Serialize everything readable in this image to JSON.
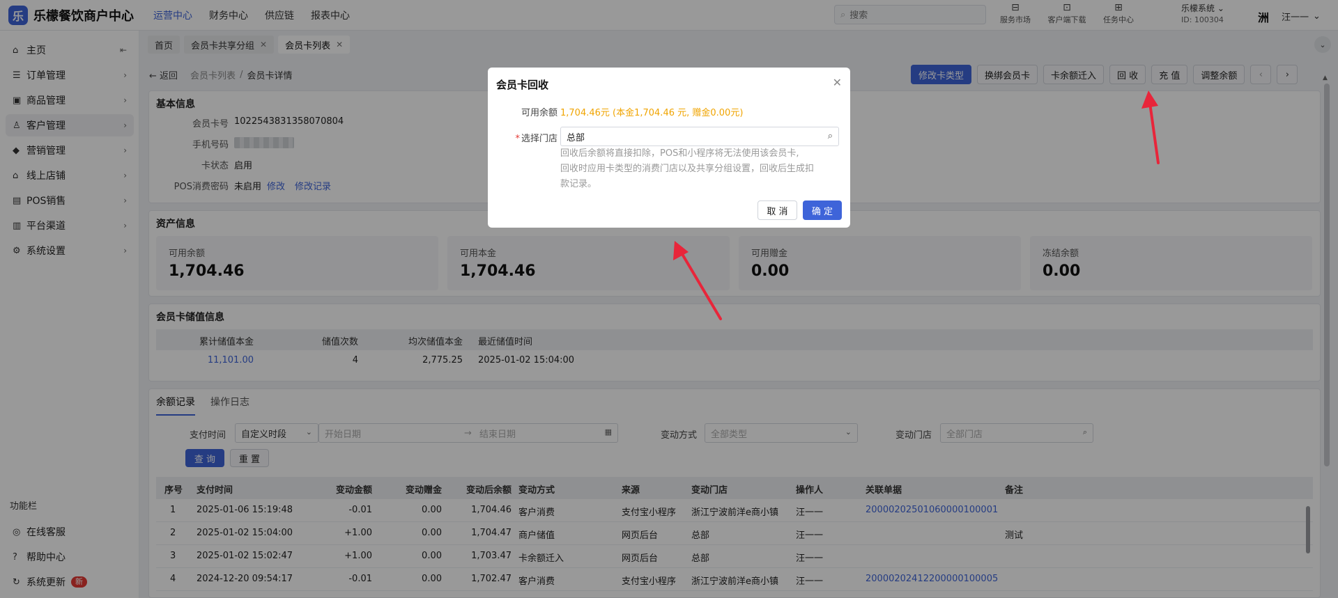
{
  "brand": {
    "mark": "乐",
    "name": "乐檬餐饮商户中心"
  },
  "topnav": [
    "运营中心",
    "财务中心",
    "供应链",
    "报表中心"
  ],
  "search": {
    "placeholder": "搜索"
  },
  "top_icons": [
    {
      "label": "服务市场",
      "icon": "store-icon"
    },
    {
      "label": "客户端下载",
      "icon": "download-icon"
    },
    {
      "label": "任务中心",
      "icon": "task-icon"
    }
  ],
  "user": {
    "system": "乐檬系统",
    "id_text": "ID: 100304",
    "name": "汪一一",
    "avatar_char": "洲"
  },
  "sidebar": {
    "items": [
      {
        "label": "主页",
        "icon": "home-icon",
        "glyph": "⌂"
      },
      {
        "label": "订单管理",
        "icon": "order-icon",
        "glyph": "☰"
      },
      {
        "label": "商品管理",
        "icon": "goods-icon",
        "glyph": "▣"
      },
      {
        "label": "客户管理",
        "icon": "user-icon",
        "glyph": "♙"
      },
      {
        "label": "营销管理",
        "icon": "tag-icon",
        "glyph": "◆"
      },
      {
        "label": "线上店铺",
        "icon": "shop-icon",
        "glyph": "⌂"
      },
      {
        "label": "POS销售",
        "icon": "pos-icon",
        "glyph": "▤"
      },
      {
        "label": "平台渠道",
        "icon": "bank-icon",
        "glyph": "▥"
      },
      {
        "label": "系统设置",
        "icon": "gear-icon",
        "glyph": "⚙"
      }
    ],
    "section_title": "功能栏",
    "tools": [
      {
        "label": "在线客服",
        "icon": "service-icon",
        "glyph": "◎"
      },
      {
        "label": "帮助中心",
        "icon": "help-icon",
        "glyph": "?"
      },
      {
        "label": "系统更新",
        "icon": "refresh-icon",
        "glyph": "↻",
        "badge": "新"
      }
    ]
  },
  "tabs": [
    {
      "label": "首页",
      "closable": false
    },
    {
      "label": "会员卡共享分组",
      "closable": true
    },
    {
      "label": "会员卡列表",
      "closable": true,
      "active": true
    }
  ],
  "breadcrumb": {
    "back": "返回",
    "parent": "会员卡列表",
    "current": "会员卡详情"
  },
  "actions": [
    "修改卡类型",
    "换绑会员卡",
    "卡余额迁入",
    "回 收",
    "充 值",
    "调整余额"
  ],
  "basic_info": {
    "title": "基本信息",
    "card_no_label": "会员卡号",
    "card_no": "1022543831358070804",
    "phone_label": "手机号码",
    "status_label": "卡状态",
    "status": "启用",
    "pos_pwd_label": "POS消费密码",
    "pos_pwd": "未启用",
    "modify": "修改",
    "modify_log": "修改记录"
  },
  "assets": {
    "title": "资产信息",
    "cards": [
      {
        "label": "可用余额",
        "value": "1,704.46"
      },
      {
        "label": "可用本金",
        "value": "1,704.46"
      },
      {
        "label": "可用赠金",
        "value": "0.00"
      },
      {
        "label": "冻结余额",
        "value": "0.00"
      }
    ]
  },
  "stored_value": {
    "title": "会员卡储值信息",
    "headers": [
      "累计储值本金",
      "储值次数",
      "均次储值本金",
      "最近储值时间"
    ],
    "row": [
      "11,101.00",
      "4",
      "2,775.25",
      "2025-01-02 15:04:00"
    ]
  },
  "records": {
    "tabs": [
      "余额记录",
      "操作日志"
    ],
    "filters": {
      "time_label": "支付时间",
      "time_mode": "自定义时段",
      "start_placeholder": "开始日期",
      "end_placeholder": "结束日期",
      "arrow": "→",
      "method_label": "变动方式",
      "method_placeholder": "全部类型",
      "store_label": "变动门店",
      "store_placeholder": "全部门店",
      "query": "查 询",
      "reset": "重 置"
    },
    "headers": [
      "序号",
      "支付时间",
      "变动金额",
      "变动赠金",
      "变动后余额",
      "变动方式",
      "来源",
      "变动门店",
      "操作人",
      "关联单据",
      "备注"
    ],
    "rows": [
      [
        "1",
        "2025-01-06 15:19:48",
        "-0.01",
        "0.00",
        "1,704.46",
        "客户消费",
        "支付宝小程序",
        "浙江宁波前洋e商小镇",
        "汪一一",
        "20000202501060000100001",
        ""
      ],
      [
        "2",
        "2025-01-02 15:04:00",
        "+1.00",
        "0.00",
        "1,704.47",
        "商户储值",
        "网页后台",
        "总部",
        "汪一一",
        "",
        "测试"
      ],
      [
        "3",
        "2025-01-02 15:02:47",
        "+1.00",
        "0.00",
        "1,703.47",
        "卡余额迁入",
        "网页后台",
        "总部",
        "汪一一",
        "",
        ""
      ],
      [
        "4",
        "2024-12-20 09:54:17",
        "-0.01",
        "0.00",
        "1,702.47",
        "客户消费",
        "支付宝小程序",
        "浙江宁波前洋e商小镇",
        "汪一一",
        "20000202412200000100005",
        ""
      ]
    ]
  },
  "modal": {
    "title": "会员卡回收",
    "balance_label": "可用余额",
    "balance_value": "1,704.46元 (本金1,704.46 元, 赠金0.00元)",
    "store_label": "选择门店",
    "store_value": "总部",
    "hint_lines": [
      "回收后余额将直接扣除，POS和小程序将无法使用该会员卡,",
      "回收时应用卡类型的消费门店以及共享分组设置，回收后生成扣",
      "款记录。"
    ],
    "cancel": "取 消",
    "confirm": "确 定"
  },
  "colors": {
    "accent": "#3e64d9",
    "warning": "#f0a400",
    "danger": "#e53935",
    "annotation": "#e8253a"
  }
}
